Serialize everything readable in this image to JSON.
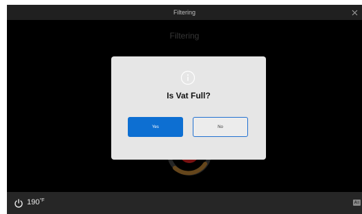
{
  "window": {
    "title": "Filtering"
  },
  "screen": {
    "heading": "Filtering"
  },
  "dialog": {
    "icon": "info-icon",
    "question": "Is Vat Full?",
    "yes_label": "Yes",
    "no_label": "No"
  },
  "statusbar": {
    "power_icon": "power-icon",
    "temperature": "190",
    "temperature_unit": "°F",
    "keyboard_icon": "keyboard-icon"
  },
  "colors": {
    "primary_button": "#0d6fd2",
    "ring_progress": "#9a6a2a",
    "ring_center": "#b71c1c"
  }
}
